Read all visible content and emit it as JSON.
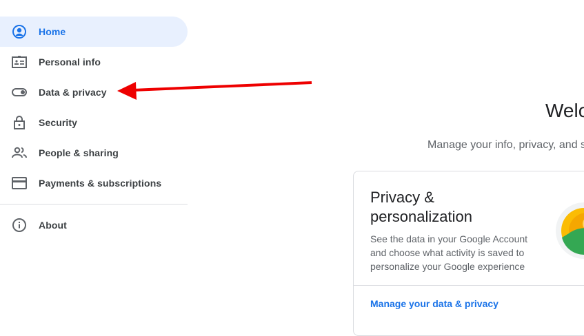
{
  "sidebar": {
    "items": [
      {
        "label": "Home",
        "icon": "account-circle-icon",
        "active": true
      },
      {
        "label": "Personal info",
        "icon": "id-card-icon"
      },
      {
        "label": "Data & privacy",
        "icon": "toggle-icon"
      },
      {
        "label": "Security",
        "icon": "lock-icon"
      },
      {
        "label": "People & sharing",
        "icon": "people-icon"
      },
      {
        "label": "Payments & subscriptions",
        "icon": "credit-card-icon"
      }
    ],
    "about": {
      "label": "About",
      "icon": "info-icon"
    }
  },
  "main": {
    "welcome": "Welc",
    "subtitle": "Manage your info, privacy, and s",
    "card": {
      "title": "Privacy & personalization",
      "description": "See the data in your Google Account and choose what activity is saved to personalize your Google experience",
      "link": "Manage your data & privacy"
    }
  },
  "annotation": {
    "arrow_color": "#ee0000",
    "points_to": "Data & privacy"
  },
  "colors": {
    "accent": "#1a73e8",
    "active_bg": "#e8f0fe"
  }
}
